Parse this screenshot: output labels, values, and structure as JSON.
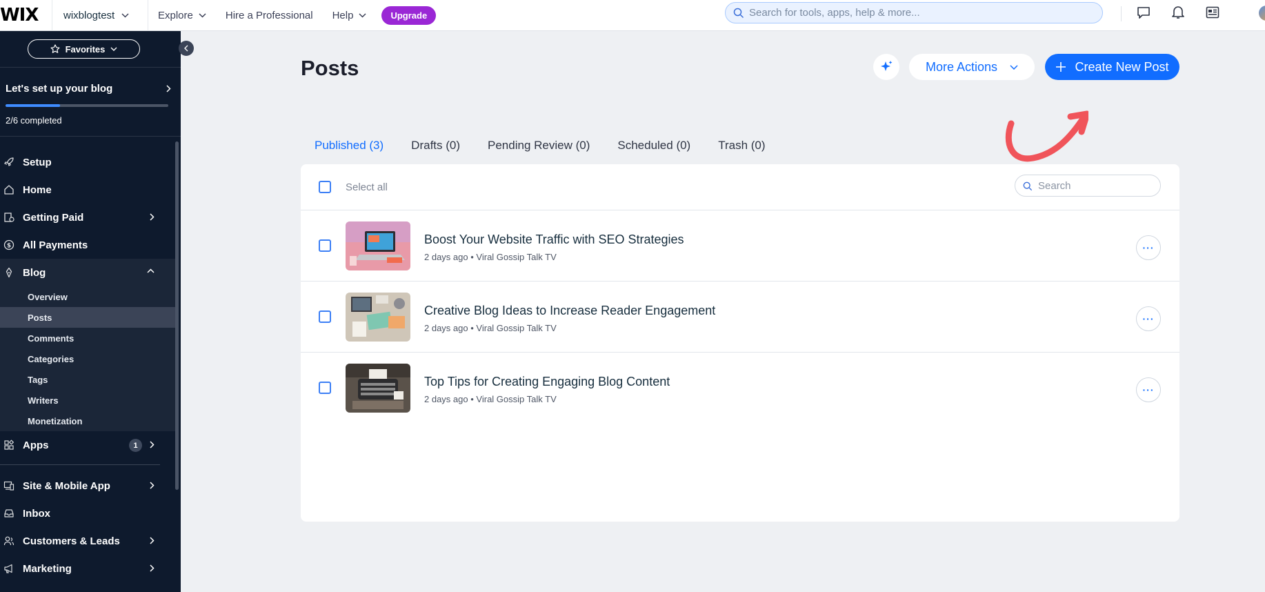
{
  "topbar": {
    "logo": "WIX",
    "site_name": "wixblogtest",
    "nav": [
      {
        "label": "Explore",
        "has_chevron": true
      },
      {
        "label": "Hire a Professional",
        "has_chevron": false
      },
      {
        "label": "Help",
        "has_chevron": true
      }
    ],
    "upgrade_label": "Upgrade",
    "search_placeholder": "Search for tools, apps, help & more...",
    "icons": [
      "chat-icon",
      "bell-icon",
      "newspaper-icon"
    ]
  },
  "sidebar": {
    "favorites_label": "Favorites",
    "setup_title": "Let's set up your blog",
    "setup_status": "2/6 completed",
    "setup_progress": 0.333,
    "items": [
      {
        "label": "Setup",
        "icon": "rocket-icon"
      },
      {
        "label": "Home",
        "icon": "home-icon"
      },
      {
        "label": "Getting Paid",
        "icon": "invoice-icon",
        "chevron": "right"
      },
      {
        "label": "All Payments",
        "icon": "dollar-icon"
      },
      {
        "label": "Blog",
        "icon": "pen-icon",
        "chevron": "up",
        "open": true
      }
    ],
    "blog_subitems": [
      "Overview",
      "Posts",
      "Comments",
      "Categories",
      "Tags",
      "Writers",
      "Monetization"
    ],
    "active_subitem": "Posts",
    "apps": {
      "label": "Apps",
      "badge": "1"
    },
    "items_after": [
      {
        "label": "Site & Mobile App",
        "icon": "devices-icon",
        "chevron": "right"
      },
      {
        "label": "Inbox",
        "icon": "inbox-icon"
      },
      {
        "label": "Customers & Leads",
        "icon": "users-icon",
        "chevron": "right"
      },
      {
        "label": "Marketing",
        "icon": "megaphone-icon",
        "chevron": "right"
      }
    ]
  },
  "main": {
    "title": "Posts",
    "more_actions_label": "More Actions",
    "create_label": "Create New Post",
    "tabs": [
      {
        "label": "Published (3)",
        "active": true
      },
      {
        "label": "Drafts (0)"
      },
      {
        "label": "Pending Review (0)"
      },
      {
        "label": "Scheduled (0)"
      },
      {
        "label": "Trash (0)"
      }
    ],
    "select_all_label": "Select all",
    "list_search_placeholder": "Search",
    "posts": [
      {
        "title": "Boost Your Website Traffic with SEO Strategies",
        "time": "2 days ago",
        "author": "Viral Gossip Talk TV"
      },
      {
        "title": "Creative Blog Ideas to Increase Reader Engagement",
        "time": "2 days ago",
        "author": "Viral Gossip Talk TV"
      },
      {
        "title": "Top Tips for Creating Engaging Blog Content",
        "time": "2 days ago",
        "author": "Viral Gossip Talk TV"
      }
    ],
    "meta_separator": "•"
  },
  "colors": {
    "accent": "#116dff",
    "sidebar_bg": "#0e1a2d",
    "upgrade": "#9a27d5",
    "annotation_arrow": "#f0545a"
  }
}
